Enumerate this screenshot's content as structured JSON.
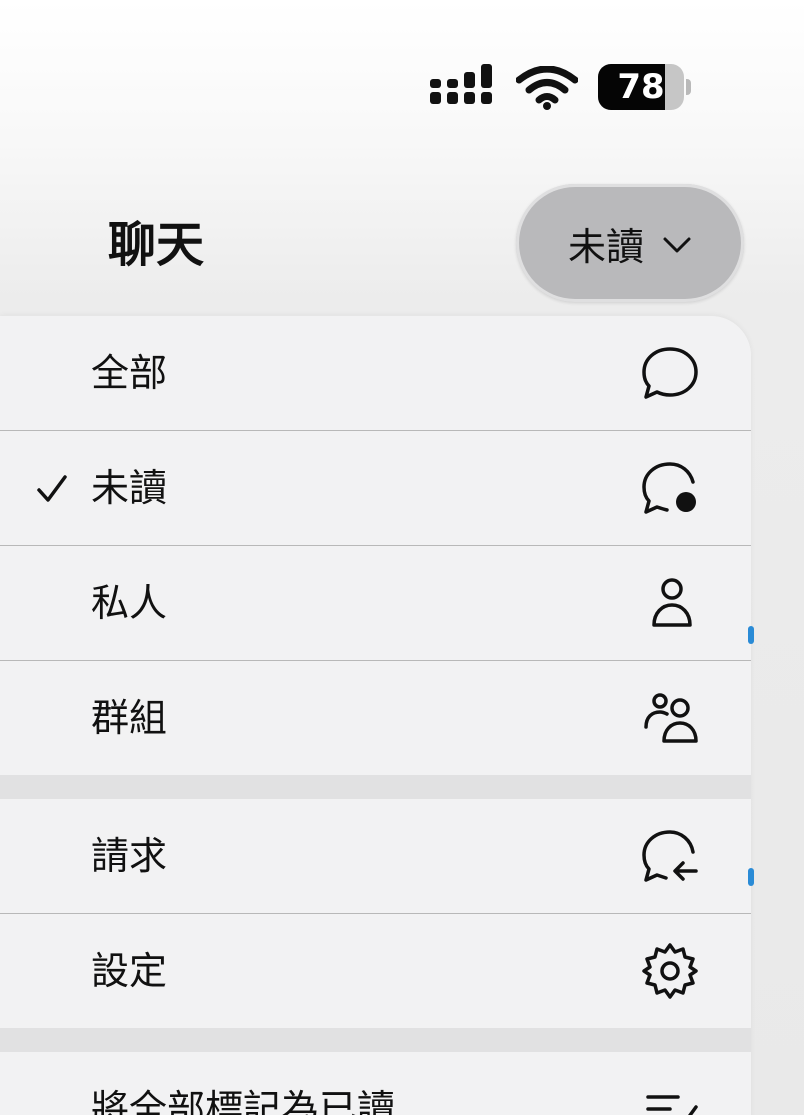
{
  "status_bar": {
    "battery_percent": "78",
    "battery_level": 0.78,
    "signal_icon": "cellular-signal-icon",
    "wifi_icon": "wifi-icon"
  },
  "header": {
    "title": "聊天",
    "filter_button": {
      "label": "未讀",
      "icon": "chevron-down-icon"
    }
  },
  "menu": {
    "items": [
      {
        "label": "全部",
        "icon": "chat-bubble-icon",
        "checked": false
      },
      {
        "label": "未讀",
        "icon": "chat-bubble-unread-icon",
        "checked": true
      },
      {
        "label": "私人",
        "icon": "person-icon",
        "checked": false
      },
      {
        "label": "群組",
        "icon": "people-icon",
        "checked": false
      },
      {
        "label": "請求",
        "icon": "chat-bubble-request-icon",
        "checked": false
      },
      {
        "label": "設定",
        "icon": "gear-icon",
        "checked": false
      },
      {
        "label": "將全部標記為已讀",
        "icon": "mark-all-read-icon",
        "checked": false
      }
    ]
  },
  "colors": {
    "menu_background": "#f2f2f3",
    "section_gap": "#e1e1e2",
    "filter_button": "#b9b9bb",
    "text": "#111111",
    "accent_edge": "#2a8bd6"
  }
}
